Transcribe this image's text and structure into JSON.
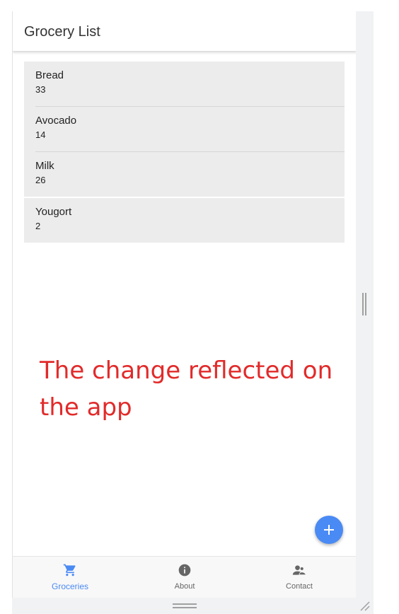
{
  "header": {
    "title": "Grocery List"
  },
  "groceries": [
    {
      "name": "Bread",
      "quantity": "33"
    },
    {
      "name": "Avocado",
      "quantity": "14"
    },
    {
      "name": "Milk",
      "quantity": "26"
    },
    {
      "name": "Yougort",
      "quantity": "2"
    }
  ],
  "annotation": {
    "text": "The change reflected on the app"
  },
  "fab": {
    "icon": "plus-icon"
  },
  "bottom_nav": {
    "active_color": "#4a8af4",
    "inactive_color": "#666666",
    "items": [
      {
        "label": "Groceries",
        "icon": "cart-icon",
        "active": true
      },
      {
        "label": "About",
        "icon": "info-icon",
        "active": false
      },
      {
        "label": "Contact",
        "icon": "contacts-icon",
        "active": false
      }
    ]
  },
  "colors": {
    "accent": "#4a8af4",
    "annotation": "#e22a2a",
    "list_background": "#ececec"
  }
}
